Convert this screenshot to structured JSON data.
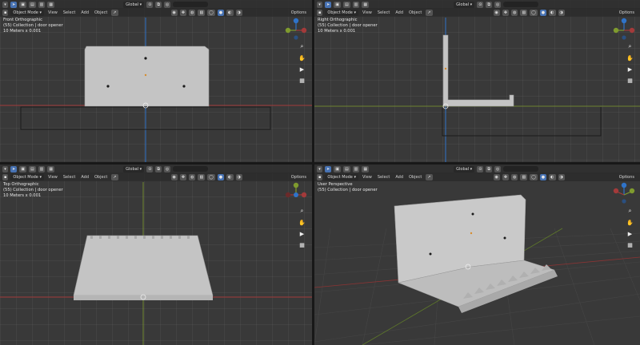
{
  "header": {
    "mode_label": "Object Mode",
    "menus": [
      "View",
      "Select",
      "Add",
      "Object"
    ],
    "orientation": "Global",
    "options_label": "Options"
  },
  "viewports": [
    {
      "name": "Front Orthographic",
      "collection": "(55) Collection | door opener",
      "scale": "10 Meters x 0.001"
    },
    {
      "name": "Right Orthographic",
      "collection": "(55) Collection | door opener",
      "scale": "10 Meters x 0.001"
    },
    {
      "name": "Top Orthographic",
      "collection": "(55) Collection | door opener",
      "scale": "10 Meters x 0.001"
    },
    {
      "name": "User Perspective",
      "collection": "(55) Collection | door opener",
      "scale": ""
    }
  ],
  "gizmo": {
    "z": "Z",
    "y": "Y",
    "x": "X"
  },
  "colors": {
    "x_axis": "#a33a3a",
    "y_axis": "#7f9b2e",
    "z_axis": "#2f73c9",
    "object": "#c4c4c4",
    "active": "#4772b3"
  }
}
